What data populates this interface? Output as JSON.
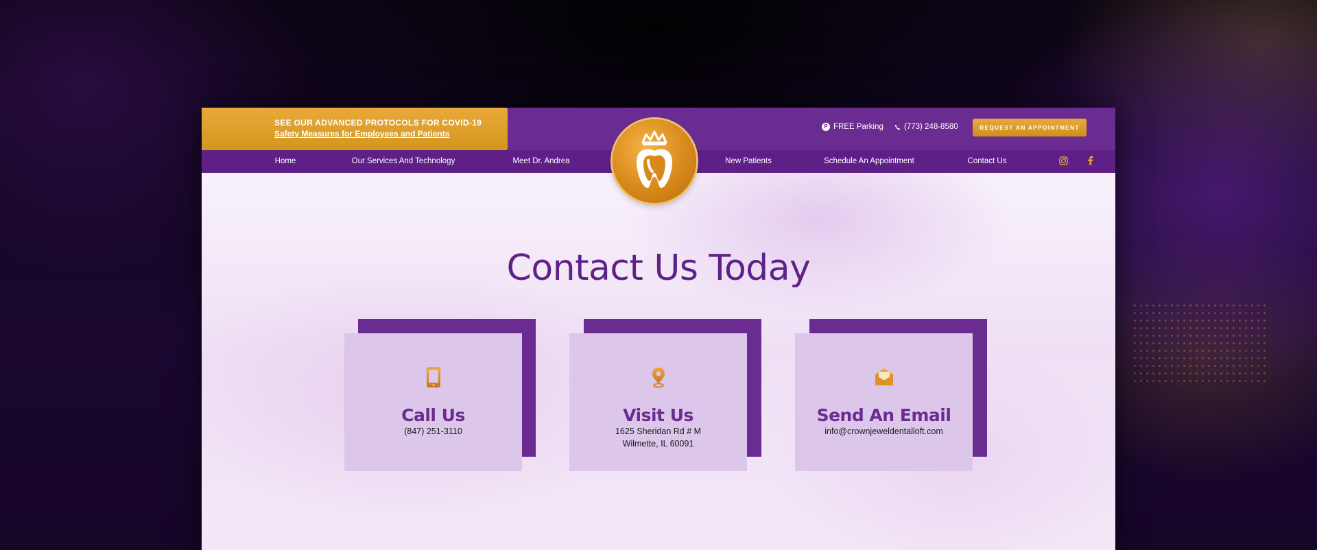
{
  "banner": {
    "line1": "SEE OUR ADVANCED PROTOCOLS FOR COVID-19",
    "line2": "Safety Measures for Employees and Patients"
  },
  "utility": {
    "parking": "FREE Parking",
    "phone": "(773) 248-8580",
    "appointment_button": "REQUEST AN APPOINTMENT"
  },
  "nav": {
    "items": [
      "Home",
      "Our Services And Technology",
      "Meet Dr. Andrea",
      "New Patients",
      "Schedule An Appointment",
      "Contact Us"
    ]
  },
  "social": [
    "instagram-icon",
    "facebook-icon"
  ],
  "main": {
    "headline": "Contact Us Today",
    "cards": [
      {
        "icon": "phone-icon",
        "title": "Call Us",
        "lines": [
          "(847) 251-3110"
        ]
      },
      {
        "icon": "location-pin-icon",
        "title": "Visit Us",
        "lines": [
          "1625 Sheridan Rd # M",
          "Wilmette, IL 60091"
        ]
      },
      {
        "icon": "envelope-icon",
        "title": "Send An Email",
        "lines": [
          "info@crownjeweldentalloft.com"
        ]
      }
    ]
  },
  "colors": {
    "purple": "#6b2c91",
    "nav_purple": "#5e1f87",
    "gold": "#e0a030",
    "card_lilac": "#dcc7ea",
    "headline": "#5e2187"
  }
}
